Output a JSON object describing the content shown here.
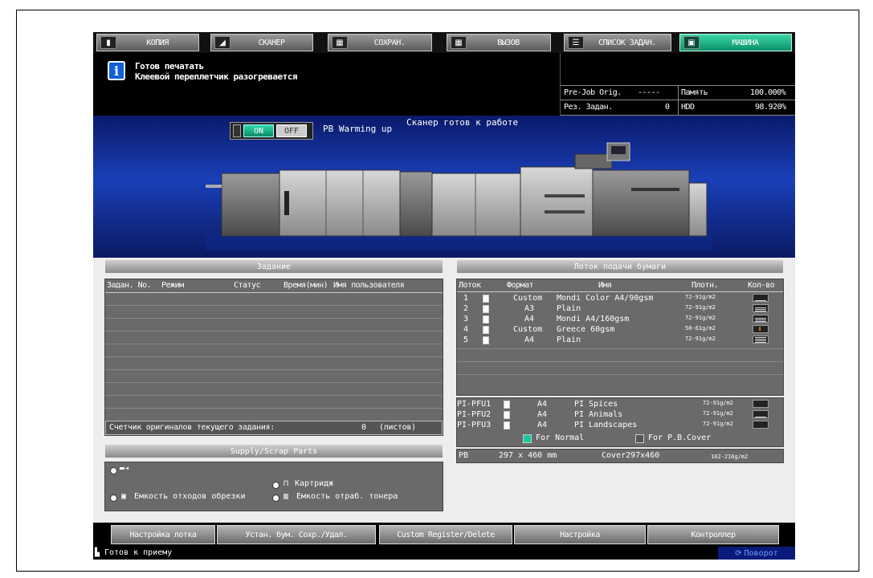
{
  "tabs": [
    {
      "label": "КОПИЯ",
      "icon": "copy-icon"
    },
    {
      "label": "СКАНЕР",
      "icon": "scanner-icon"
    },
    {
      "label": "СОХРАН.",
      "icon": "save-icon"
    },
    {
      "label": "ВЫЗОВ",
      "icon": "recall-icon"
    },
    {
      "label": "СПИСОК ЗАДАН.",
      "icon": "joblist-icon"
    },
    {
      "label": "МАШИНА",
      "icon": "machine-icon"
    }
  ],
  "message": {
    "line1": "Готов печатать",
    "line2": "Клеевой переплетчик разогревается"
  },
  "info": {
    "prejob_label": "Pre-Job Orig.",
    "prejob_value": "-----",
    "res_label": "Рез. Задан.",
    "res_value": "0",
    "memory_label": "Память",
    "memory_value": "100.000%",
    "hdd_label": "HDD",
    "hdd_value": "98.920%"
  },
  "banner": {
    "on_label": "ON",
    "off_label": "OFF",
    "pb_warming": "PB Warming up",
    "scanner_ready": "Сканер готов к работе"
  },
  "jobs": {
    "title": "Задание",
    "headers": [
      "Задан. No.",
      "Режим",
      "Статус",
      "Время(мин)",
      "Имя пользователя"
    ],
    "counter_label": "Счетчик оригиналов текущего задания:",
    "counter_value": "0",
    "counter_unit": "(листов)"
  },
  "supply": {
    "title": "Supply/Scrap Parts",
    "cartridge": "Картридж",
    "trim_waste": "Емкость отходов обрезки",
    "toner_waste": "Емкость отраб. тонера"
  },
  "trays": {
    "title": "Лоток подачи бумаги",
    "headers": [
      "Лоток",
      "Формат",
      "Имя",
      "Плотн.",
      "Кол-во"
    ],
    "rows": [
      {
        "no": "1",
        "format": "Custom",
        "name": "Mondi Color A4/90gsm",
        "weight": "72-91g/m2",
        "level": 1
      },
      {
        "no": "2",
        "format": "A3",
        "name": "Plain",
        "weight": "72-91g/m2",
        "level": 3
      },
      {
        "no": "3",
        "format": "A4",
        "name": "Mondi A4/160gsm",
        "weight": "72-91g/m2",
        "level": 3
      },
      {
        "no": "4",
        "format": "Custom",
        "name": "Greece 60gsm",
        "weight": "50-61g/m2",
        "level": 0
      },
      {
        "no": "5",
        "format": "A4",
        "name": "Plain",
        "weight": "72-91g/m2",
        "level": 4
      }
    ],
    "pi": [
      {
        "no": "PI-PFU1",
        "format": "A4",
        "name": "PI Spices",
        "weight": "72-91g/m2"
      },
      {
        "no": "PI-PFU2",
        "format": "A4",
        "name": "PI Animals",
        "weight": "72-91g/m2"
      },
      {
        "no": "PI-PFU3",
        "format": "A4",
        "name": "PI Landscapes",
        "weight": "72-91g/m2"
      }
    ],
    "for_normal": "For Normal",
    "for_cover": "For P.B.Cover",
    "pb_label": "PB",
    "pb_size": "297 x 460 mm",
    "pb_cover": "Cover297x460",
    "pb_weight": "162-216g/m2"
  },
  "buttons": [
    "Настройка лотка",
    "Устан. бум. Сохр./Удал.",
    "Custom Register/Delete",
    "Настройка",
    "Контроллер"
  ],
  "status": {
    "ready": "Готов к приему",
    "rotate": "Поворот"
  },
  "colors": {
    "active_tab": "#1bb98c",
    "banner_blue": "#1a3fb8",
    "info_blue": "#1060d8"
  }
}
